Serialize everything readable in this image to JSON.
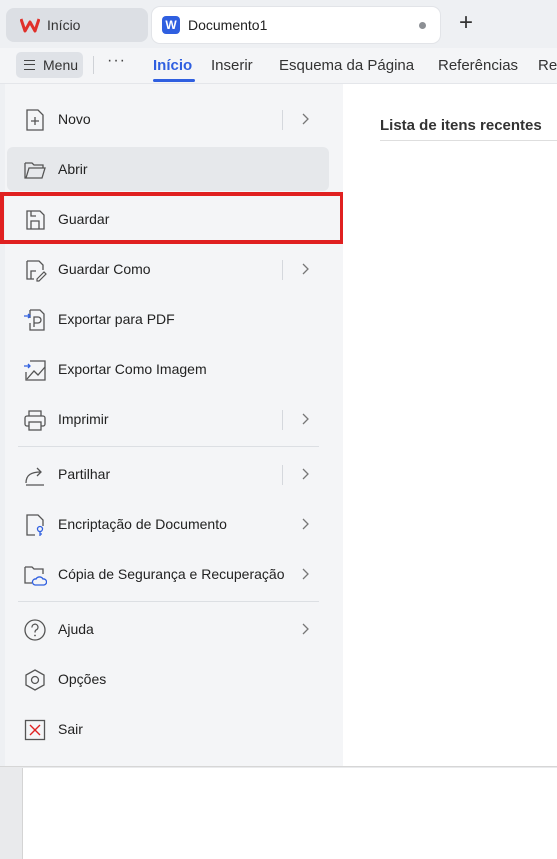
{
  "tabs": {
    "home_label": "Início",
    "doc_label": "Documento1",
    "doc_badge": "W",
    "new_tab_symbol": "+"
  },
  "ribbon": {
    "menu_label": "Menu",
    "more_symbol": "···",
    "tabs": [
      "Início",
      "Inserir",
      "Esquema da Página",
      "Referências",
      "Rev"
    ]
  },
  "menu": {
    "items": [
      {
        "label": "Novo",
        "icon": "new-file-icon",
        "submenu": true
      },
      {
        "label": "Abrir",
        "icon": "folder-open-icon",
        "submenu": false
      },
      {
        "label": "Guardar",
        "icon": "save-icon",
        "submenu": false
      },
      {
        "label": "Guardar Como",
        "icon": "save-as-icon",
        "submenu": true
      },
      {
        "label": "Exportar para PDF",
        "icon": "export-pdf-icon",
        "submenu": false
      },
      {
        "label": "Exportar Como Imagem",
        "icon": "export-image-icon",
        "submenu": false
      },
      {
        "label": "Imprimir",
        "icon": "printer-icon",
        "submenu": true
      },
      {
        "label": "Partilhar",
        "icon": "share-icon",
        "submenu": true
      },
      {
        "label": "Encriptação de Documento",
        "icon": "encrypt-document-icon",
        "submenu": true
      },
      {
        "label": "Cópia de Segurança e Recuperação",
        "icon": "backup-cloud-icon",
        "submenu": true
      },
      {
        "label": "Ajuda",
        "icon": "help-icon",
        "submenu": true
      },
      {
        "label": "Opções",
        "icon": "options-icon",
        "submenu": false
      },
      {
        "label": "Sair",
        "icon": "exit-icon",
        "submenu": false
      }
    ]
  },
  "recent": {
    "title": "Lista de itens recentes"
  },
  "colors": {
    "accent": "#2f5fe0",
    "highlight": "#e02020",
    "brand_red": "#e0302a"
  }
}
